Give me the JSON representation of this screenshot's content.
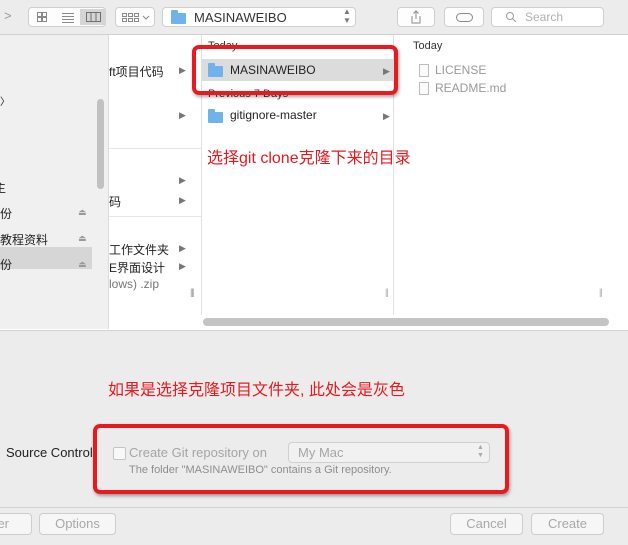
{
  "toolbar": {
    "path_label": "MASINAWEIBO",
    "search_placeholder": "Search"
  },
  "sidebar": {
    "items": [
      {
        "label": "〉"
      },
      {
        "label": "主"
      },
      {
        "label": "份"
      },
      {
        "label": "教程资料"
      },
      {
        "label": "份"
      }
    ]
  },
  "column1": {
    "items": [
      {
        "label": "ft项目代码"
      },
      {
        "label": "码"
      },
      {
        "label": "工作文件夹"
      },
      {
        "label": "E界面设计"
      },
      {
        "label": "lows) .zip"
      }
    ]
  },
  "column2": {
    "section_today": "Today",
    "section_previous": "Previous 7 Days",
    "items": [
      {
        "label": "MASINAWEIBO"
      },
      {
        "label": "gitignore-master"
      }
    ]
  },
  "column3": {
    "section_today": "Today",
    "files": [
      {
        "label": "LICENSE"
      },
      {
        "label": "README.md"
      }
    ]
  },
  "annotations": {
    "note1": "选择git clone克隆下来的目录",
    "note2": "如果是选择克隆项目文件夹, 此处会是灰色",
    "color": "#e8191f"
  },
  "options": {
    "source_control_label": "Source Control",
    "create_repo_label": "Create Git repository on",
    "location_value": "My Mac",
    "info_text": "The folder \"MASINAWEIBO\" contains a Git repository."
  },
  "footer": {
    "left_button": "er",
    "options_button": "Options",
    "cancel_button": "Cancel",
    "create_button": "Create"
  }
}
